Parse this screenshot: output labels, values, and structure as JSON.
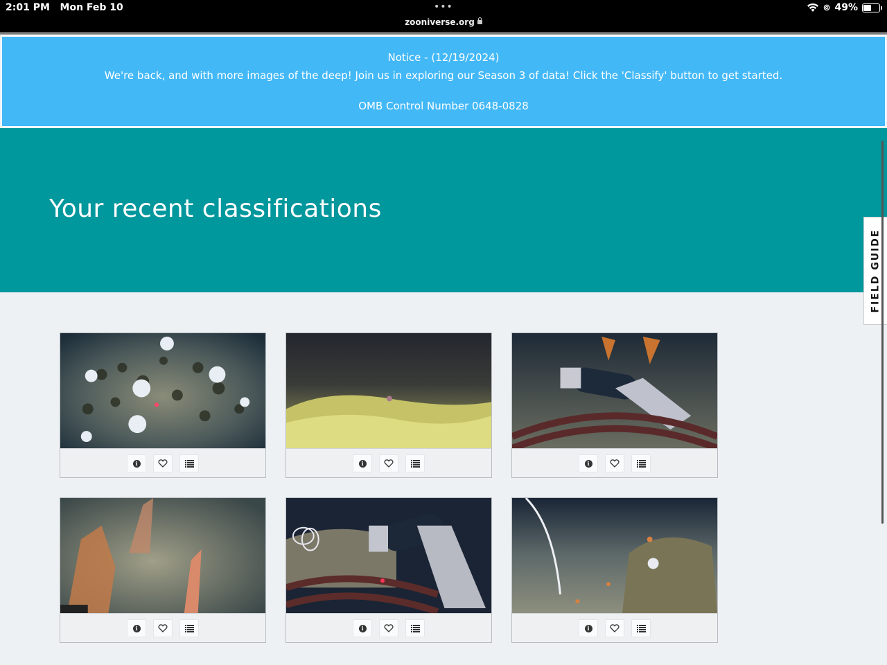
{
  "status_bar": {
    "time": "2:01 PM",
    "date": "Mon Feb 10",
    "url": "zooniverse.org",
    "battery": "49%",
    "battery_level": 0.49
  },
  "notice": {
    "line1": "Notice - (12/19/2024)",
    "line2": "We're back, and with more images of the deep! Join us in exploring our Season 3 of data! Click the 'Classify' button to get started.",
    "line3": "OMB Control Number 0648-0828"
  },
  "hero": {
    "title": "Your recent classifications"
  },
  "field_guide": {
    "label": "FIELD GUIDE"
  },
  "colors": {
    "notice_bg": "#43b8f7",
    "hero_bg": "#00979d",
    "page_bg": "#eef1f4"
  },
  "classifications": [
    {
      "id": "card-1",
      "scene": "white-coral-seabed"
    },
    {
      "id": "card-2",
      "scene": "yellow-reef-dark"
    },
    {
      "id": "card-3",
      "scene": "robot-arm-orange-coral"
    },
    {
      "id": "card-4",
      "scene": "orange-sea-fans"
    },
    {
      "id": "card-5",
      "scene": "robot-arm-reef"
    },
    {
      "id": "card-6",
      "scene": "white-cable-seabed"
    }
  ],
  "card_actions": [
    "info-icon",
    "heart-icon",
    "list-icon"
  ]
}
